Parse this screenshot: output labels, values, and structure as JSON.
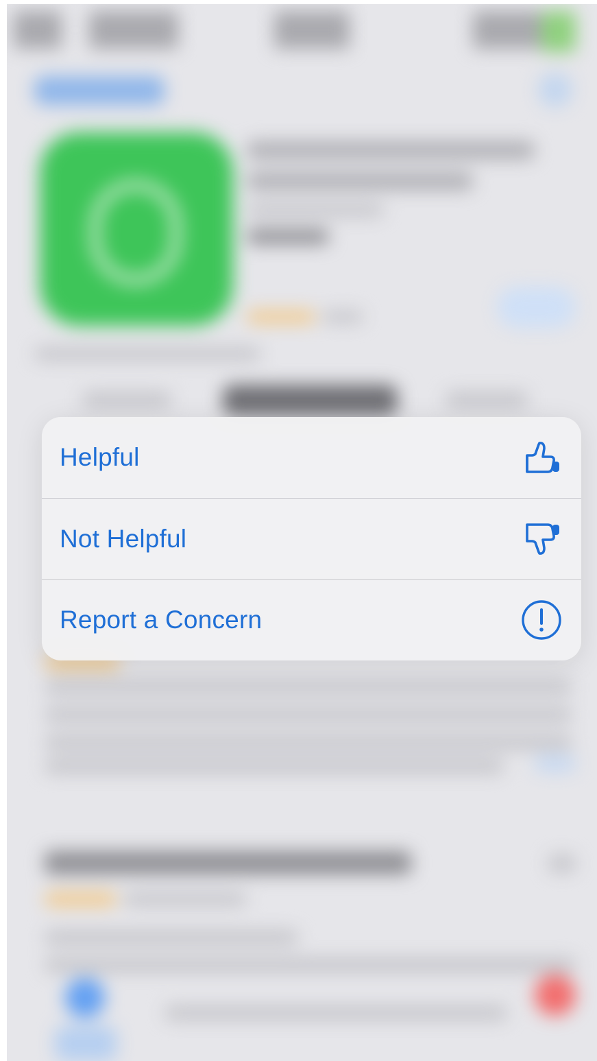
{
  "action_menu": {
    "items": [
      {
        "label": "Helpful",
        "icon": "thumbs-up-icon"
      },
      {
        "label": "Not Helpful",
        "icon": "thumbs-down-icon"
      },
      {
        "label": "Report a Concern",
        "icon": "exclamation-circle-icon"
      }
    ]
  },
  "colors": {
    "accent": "#1f6fd6",
    "menu_background": "#f1f1f3",
    "separator": "#c9c9ce",
    "app_icon_green": "#3ec559"
  }
}
